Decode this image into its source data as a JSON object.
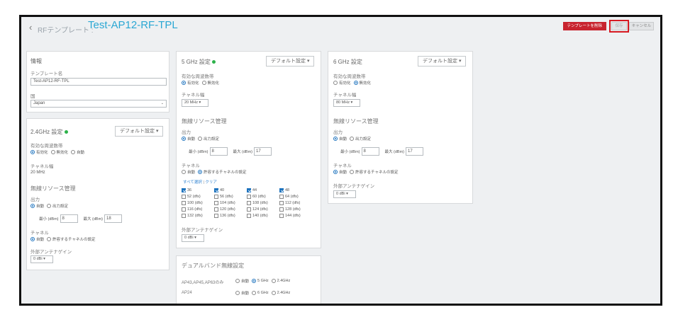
{
  "header": {
    "back_icon": "chevron-left-icon",
    "breadcrumb": "RFテンプレート :",
    "title": "Test-AP12-RF-TPL",
    "delete_label": "テンプレートを削除",
    "save_label": "保存",
    "cancel_label": "キャンセル"
  },
  "info": {
    "title": "情報",
    "template_name_label": "テンプレート名",
    "template_name_value": "Test-AP12-RF-TPL",
    "country_label": "国",
    "country_value": "Japan"
  },
  "band24": {
    "title": "2.4GHz 設定",
    "default_label": "デフォルト設定",
    "enabled_label": "有効な周波数帯",
    "enabled_options": [
      "有効化",
      "無効化",
      "自動"
    ],
    "channel_width_label": "チャネル幅",
    "channel_width_value": "20 MHz",
    "rrm_title": "無線リソース管理",
    "power_label": "出力",
    "power_options": [
      "自動",
      "出力設定"
    ],
    "min_label": "最小 (dBm)",
    "min_value": "8",
    "max_label": "最大 (dBm)",
    "max_value": "18",
    "channel_label": "チャネル",
    "channel_options": [
      "自動",
      "許容するチャネルの設定"
    ],
    "antenna_label": "外部アンテナゲイン",
    "antenna_value": "0 dBi"
  },
  "band5": {
    "title": "5 GHz 設定",
    "default_label": "デフォルト設定",
    "enabled_label": "有効な周波数帯",
    "enabled_options": [
      "有効化",
      "無効化"
    ],
    "channel_width_label": "チャネル幅",
    "channel_width_value": "20 MHz",
    "rrm_title": "無線リソース管理",
    "power_label": "出力",
    "power_options": [
      "自動",
      "出力設定"
    ],
    "min_label": "最小 (dBm)",
    "min_value": "8",
    "max_label": "最大 (dBm)",
    "max_value": "17",
    "channel_label": "チャネル",
    "channel_options": [
      "自動",
      "許容するチャネルの設定"
    ],
    "select_all": "すべて選択",
    "separator": "|",
    "clear": "クリア",
    "channels": [
      {
        "label": "36",
        "checked": true
      },
      {
        "label": "40",
        "checked": true
      },
      {
        "label": "44",
        "checked": true
      },
      {
        "label": "48",
        "checked": true
      },
      {
        "label": "52  (dfs)",
        "checked": false
      },
      {
        "label": "56  (dfs)",
        "checked": false
      },
      {
        "label": "60  (dfs)",
        "checked": false
      },
      {
        "label": "64  (dfs)",
        "checked": false
      },
      {
        "label": "100  (dfs)",
        "checked": false
      },
      {
        "label": "104  (dfs)",
        "checked": false
      },
      {
        "label": "108  (dfs)",
        "checked": false
      },
      {
        "label": "112  (dfs)",
        "checked": false
      },
      {
        "label": "116  (dfs)",
        "checked": false
      },
      {
        "label": "120  (dfs)",
        "checked": false
      },
      {
        "label": "124  (dfs)",
        "checked": false
      },
      {
        "label": "128  (dfs)",
        "checked": false
      },
      {
        "label": "132  (dfs)",
        "checked": false
      },
      {
        "label": "136  (dfs)",
        "checked": false
      },
      {
        "label": "140  (dfs)",
        "checked": false
      },
      {
        "label": "144  (dfs)",
        "checked": false
      }
    ],
    "antenna_label": "外部アンテナゲイン",
    "antenna_value": "0 dBi"
  },
  "band6": {
    "title": "6 GHz 設定",
    "default_label": "デフォルト設定",
    "enabled_label": "有効な周波数帯",
    "enabled_options": [
      "有効化",
      "無効化"
    ],
    "channel_width_label": "チャネル幅",
    "channel_width_value": "80 MHz",
    "rrm_title": "無線リソース管理",
    "power_label": "出力",
    "power_options": [
      "自動",
      "出力設定"
    ],
    "min_label": "最小 (dBm)",
    "min_value": "8",
    "max_label": "最大 (dBm)",
    "max_value": "17",
    "channel_label": "チャネル",
    "channel_options": [
      "自動",
      "許容するチャネルの設定"
    ],
    "antenna_label": "外部アンテナゲイン",
    "antenna_value": "0 dBi"
  },
  "dual": {
    "title": "デュアルバンド無線設定",
    "row1_label": "AP43,AP45,AP63のみ",
    "row1_options": [
      "自動",
      "5 GHz",
      "2.4GHz"
    ],
    "row2_label": "AP24",
    "row2_options": [
      "自動",
      "6 GHz",
      "2.4GHz"
    ]
  }
}
